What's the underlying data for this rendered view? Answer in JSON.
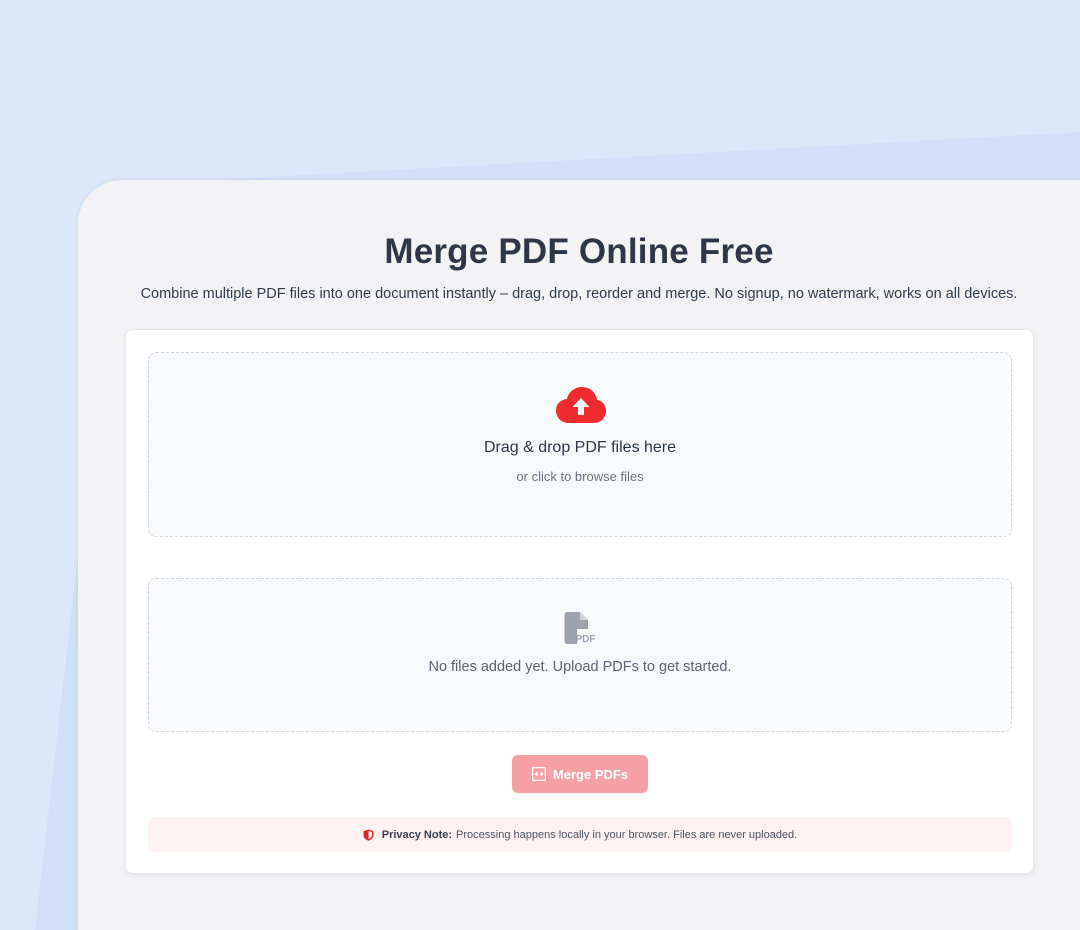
{
  "page": {
    "title": "Merge PDF Online Free",
    "subtitle": "Combine multiple PDF files into one document instantly – drag, drop, reorder and merge. No signup, no watermark, works on all devices."
  },
  "dropzone": {
    "icon": "cloud-upload-icon",
    "title": "Drag & drop PDF files here",
    "subtitle": "or click to browse files"
  },
  "file_list": {
    "icon": "pdf-file-icon",
    "empty_message": "No files added yet. Upload PDFs to get started."
  },
  "merge_button": {
    "icon": "merge-icon",
    "label": "Merge PDFs"
  },
  "privacy_note": {
    "icon": "shield-icon",
    "label": "Privacy Note:",
    "text": "Processing happens locally in your browser. Files are never uploaded."
  },
  "colors": {
    "background": "#dbe8fb",
    "accent": "#ef2b2d",
    "button_disabled": "#f6a0a4",
    "heading": "#2d3748"
  }
}
